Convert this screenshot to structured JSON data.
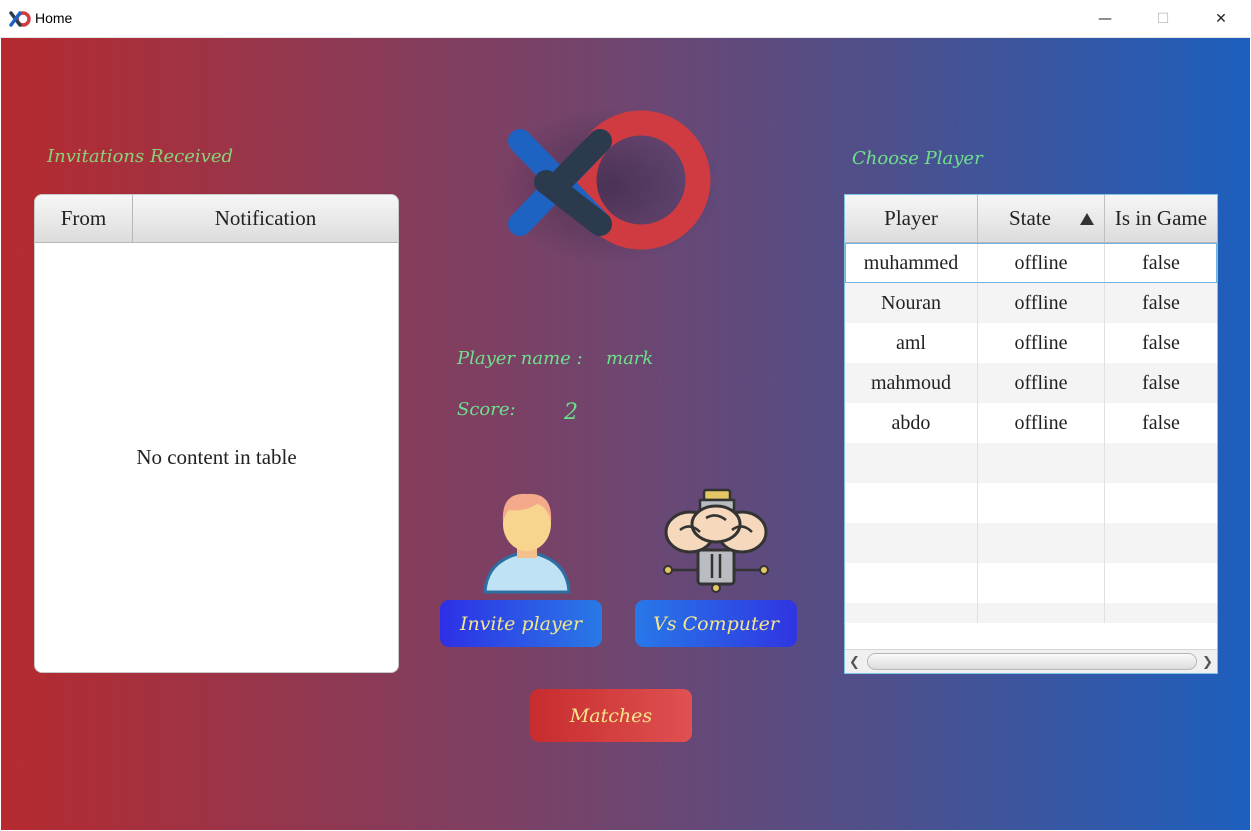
{
  "window": {
    "title": "Home",
    "minimize_glyph": "—",
    "maximize_glyph": "☐",
    "close_glyph": "✕"
  },
  "invitations": {
    "title": "Invitations Received",
    "columns": [
      "From",
      "Notification"
    ],
    "empty_text": "No content in table"
  },
  "player_info": {
    "name_label": "Player name :",
    "name_value": "mark",
    "score_label": "Score:",
    "score_value": "2"
  },
  "actions": {
    "invite_label": "Invite player",
    "vs_computer_label": "Vs Computer",
    "matches_label": "Matches"
  },
  "choose_player": {
    "title": "Choose Player",
    "columns": [
      "Player",
      "State",
      "Is in Game"
    ],
    "sorted_column": "State",
    "rows": [
      [
        "muhammed",
        "offline",
        "false"
      ],
      [
        "Nouran",
        "offline",
        "false"
      ],
      [
        "aml",
        "offline",
        "false"
      ],
      [
        "mahmoud",
        "offline",
        "false"
      ],
      [
        "abdo",
        "offline",
        "false"
      ]
    ],
    "empty_rows": 5
  },
  "colors": {
    "accent_green": "#6ee08c",
    "button_text": "#f3e690",
    "logo_blue": "#1f63c2",
    "logo_dark": "#2c3a4e",
    "logo_red": "#d03b41"
  },
  "icons": {
    "app": "xo-logo-icon",
    "invite": "person-icon",
    "computer": "robot-brain-icon"
  }
}
